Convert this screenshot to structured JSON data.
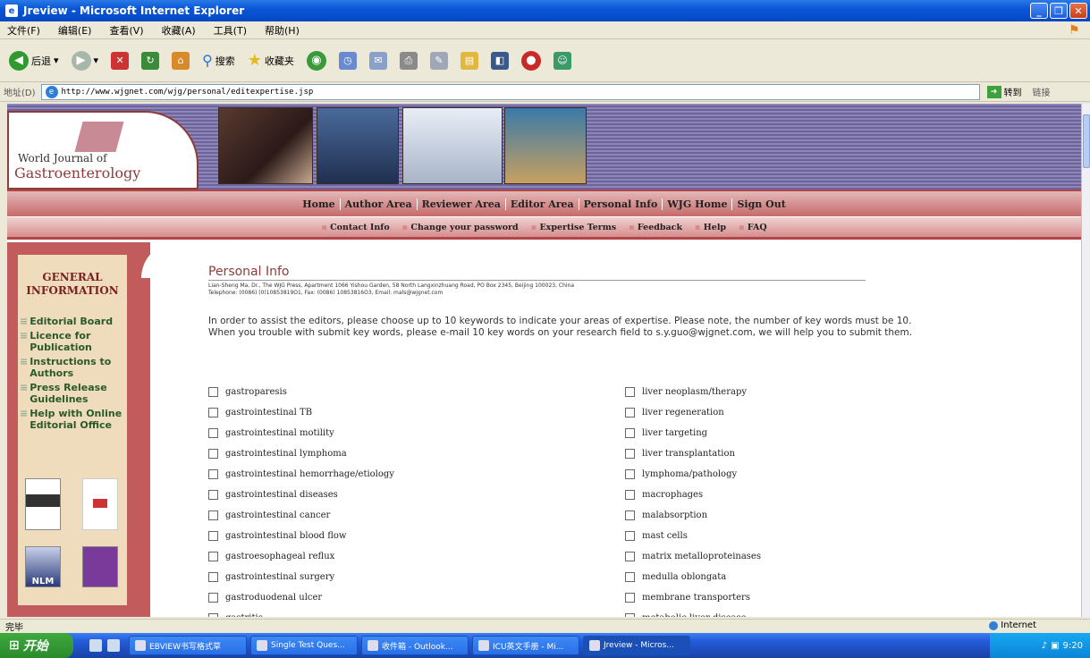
{
  "window": {
    "title": "Jreview - Microsoft Internet Explorer"
  },
  "menu": [
    "文件(F)",
    "编辑(E)",
    "查看(V)",
    "收藏(A)",
    "工具(T)",
    "帮助(H)"
  ],
  "toolbar": {
    "back": "后退",
    "search": "搜索",
    "favorites": "收藏夹"
  },
  "address": {
    "label": "地址(D)",
    "url": "http://www.wjgnet.com/wjg/personal/editexpertise.jsp",
    "go": "转到",
    "links": "链接"
  },
  "site": {
    "logo_line1": "World Journal of",
    "logo_line2": "Gastroenterology"
  },
  "nav_main": [
    "Home",
    "Author Area",
    "Reviewer Area",
    "Editor Area",
    "Personal Info",
    "WJG Home",
    "Sign Out"
  ],
  "nav_sub": [
    "Contact Info",
    "Change your password",
    "Expertise Terms",
    "Feedback",
    "Help",
    "FAQ"
  ],
  "sidebar": {
    "heading": "GENERAL INFORMATION",
    "links": [
      "Editorial Board",
      "Licence for Publication",
      "Instructions to Authors",
      "Press Release Guidelines",
      "Help with Online Editorial Office"
    ],
    "nlm": "NLM"
  },
  "page": {
    "title": "Personal Info",
    "address_line1": "Lian-Sheng Ma, Dr., The WJG Press, Apartment 1066 Yishou Garden, 58 North Langxinzhuang Road, PO Box 2345, Beijing 100023, China",
    "address_line2": "Telephone: (0086) (0)10853819O1, Fax: (0086) 10853816O3, Email: mals@wjgnet.com",
    "intro_line1": "In order to assist the editors, please choose up to 10 keywords to indicate your areas of expertise. Please note, the number of key words must be 10.",
    "intro_line2": "When you trouble with submit key words, please e-mail 10 key words on your research field to s.y.guo@wjgnet.com, we will help you to submit them."
  },
  "keywords_left": [
    "gastroparesis",
    "gastrointestinal TB",
    "gastrointestinal motility",
    "gastrointestinal lymphoma",
    "gastrointestinal hemorrhage/etiology",
    "gastrointestinal diseases",
    "gastrointestinal cancer",
    "gastrointestinal blood flow",
    "gastroesophageal reflux",
    "gastrointestinal surgery",
    "gastroduodenal ulcer",
    "gastritis"
  ],
  "keywords_right": [
    "liver neoplasm/therapy",
    "liver regeneration",
    "liver targeting",
    "liver transplantation",
    "lymphoma/pathology",
    "macrophages",
    "malabsorption",
    "mast cells",
    "matrix metalloproteinases",
    "medulla oblongata",
    "membrane transporters",
    "metabolic liver disease"
  ],
  "status": {
    "text": "完毕",
    "zone": "Internet"
  },
  "taskbar": {
    "start": "开始",
    "tasks": [
      "EBVIEW书写格式草",
      "Single Test Ques...",
      "收件箱 - Outlook...",
      "ICU英文手册 - Mi...",
      "Jreview - Micros..."
    ],
    "clock": "9:20"
  }
}
